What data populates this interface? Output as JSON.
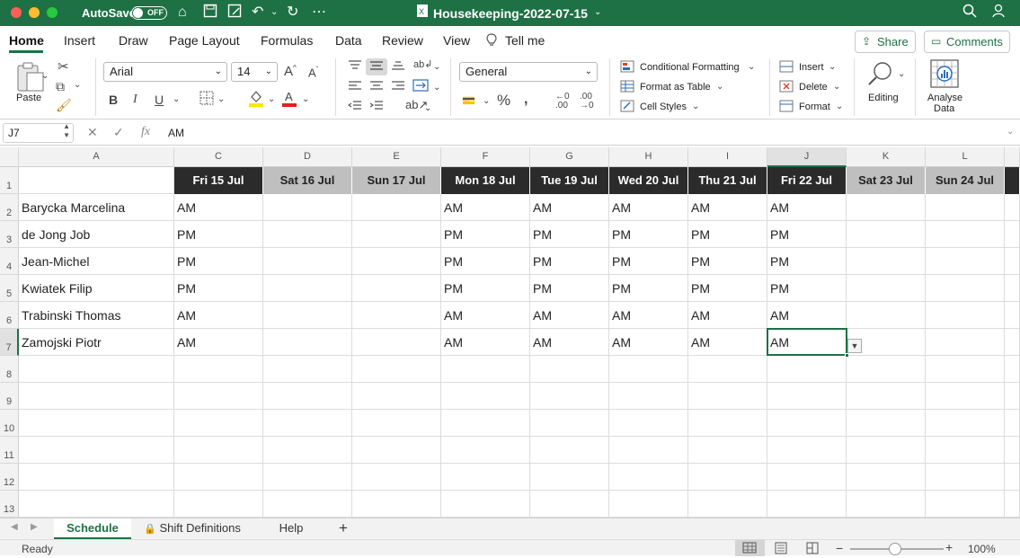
{
  "window": {
    "autosave_label": "AutoSave",
    "autosave_state": "OFF",
    "doc_title": "Housekeeping-2022-07-15"
  },
  "menu": {
    "tabs": [
      "Home",
      "Insert",
      "Draw",
      "Page Layout",
      "Formulas",
      "Data",
      "Review",
      "View"
    ],
    "tell_me": "Tell me",
    "share": "Share",
    "comments": "Comments"
  },
  "ribbon": {
    "paste": "Paste",
    "font_name": "Arial",
    "font_size": "14",
    "number_format": "General",
    "conditional_formatting": "Conditional Formatting",
    "format_as_table": "Format as Table",
    "cell_styles": "Cell Styles",
    "insert": "Insert",
    "delete": "Delete",
    "format": "Format",
    "editing": "Editing",
    "analyse_data_1": "Analyse",
    "analyse_data_2": "Data",
    "bold": "B",
    "italic": "I",
    "underline": "U",
    "percent": "%"
  },
  "formula_bar": {
    "name_box": "J7",
    "fx": "fx",
    "value": "AM"
  },
  "grid": {
    "columns": [
      "A",
      "C",
      "D",
      "E",
      "F",
      "G",
      "H",
      "I",
      "J",
      "K",
      "L"
    ],
    "row_numbers": [
      "1",
      "2",
      "3",
      "4",
      "5",
      "6",
      "7",
      "8",
      "9",
      "10",
      "11",
      "12",
      "13"
    ],
    "date_headers": [
      "Fri 15 Jul",
      "Sat 16 Jul",
      "Sun 17 Jul",
      "Mon 18 Jul",
      "Tue 19 Jul",
      "Wed 20 Jul",
      "Thu 21 Jul",
      "Fri 22 Jul",
      "Sat 23 Jul",
      "Sun 24 Jul"
    ],
    "rows": [
      {
        "name": "Barycka Marcelina",
        "shifts": [
          "AM",
          "",
          "",
          "AM",
          "AM",
          "AM",
          "AM",
          "AM",
          "",
          ""
        ]
      },
      {
        "name": "de Jong Job",
        "shifts": [
          "PM",
          "",
          "",
          "PM",
          "PM",
          "PM",
          "PM",
          "PM",
          "",
          ""
        ]
      },
      {
        "name": "Jean-Michel",
        "shifts": [
          "PM",
          "",
          "",
          "PM",
          "PM",
          "PM",
          "PM",
          "PM",
          "",
          ""
        ]
      },
      {
        "name": "Kwiatek Filip",
        "shifts": [
          "PM",
          "",
          "",
          "PM",
          "PM",
          "PM",
          "PM",
          "PM",
          "",
          ""
        ]
      },
      {
        "name": "Trabinski Thomas",
        "shifts": [
          "AM",
          "",
          "",
          "AM",
          "AM",
          "AM",
          "AM",
          "AM",
          "",
          ""
        ]
      },
      {
        "name": "Zamojski Piotr",
        "shifts": [
          "AM",
          "",
          "",
          "AM",
          "AM",
          "AM",
          "AM",
          "AM",
          "",
          ""
        ]
      }
    ],
    "selected_cell": "J7"
  },
  "sheets": {
    "tabs": [
      "Schedule",
      "Shift Definitions",
      "Help"
    ],
    "active": "Schedule",
    "add": "+"
  },
  "status": {
    "ready": "Ready",
    "zoom": "100%",
    "zoom_minus": "−",
    "zoom_plus": "+"
  },
  "colors": {
    "brand_green": "#1e7145",
    "weekday_header_bg": "#2b2b2b",
    "weekend_header_bg": "#bfbfbf"
  }
}
